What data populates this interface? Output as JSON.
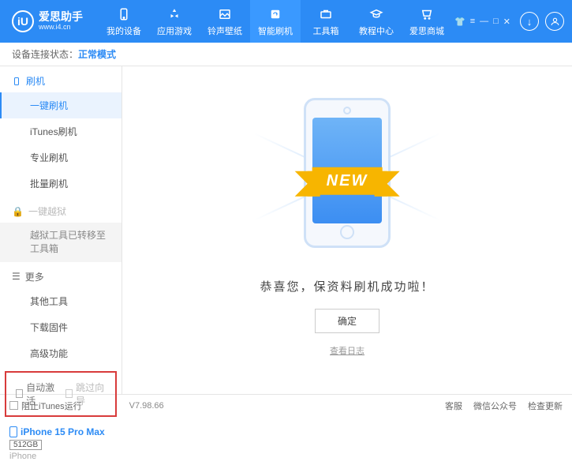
{
  "logo": {
    "icon": "iU",
    "title": "爱思助手",
    "subtitle": "www.i4.cn"
  },
  "nav": {
    "items": [
      {
        "label": "我的设备"
      },
      {
        "label": "应用游戏"
      },
      {
        "label": "铃声壁纸"
      },
      {
        "label": "智能刷机"
      },
      {
        "label": "工具箱"
      },
      {
        "label": "教程中心"
      },
      {
        "label": "爱思商城"
      }
    ]
  },
  "status": {
    "label": "设备连接状态：",
    "mode": "正常模式"
  },
  "sidebar": {
    "sec1": {
      "title": "刷机",
      "items": [
        "一键刷机",
        "iTunes刷机",
        "专业刷机",
        "批量刷机"
      ]
    },
    "sec2": {
      "title": "一键越狱",
      "note": "越狱工具已转移至工具箱"
    },
    "sec3": {
      "title": "更多",
      "items": [
        "其他工具",
        "下载固件",
        "高级功能"
      ]
    },
    "checks": {
      "auto_activate": "自动激活",
      "skip_setup": "跳过向导"
    },
    "device": {
      "name": "iPhone 15 Pro Max",
      "storage": "512GB",
      "type": "iPhone"
    }
  },
  "main": {
    "badge": "NEW",
    "success": "恭喜您，保资料刷机成功啦！",
    "ok": "确定",
    "log": "查看日志"
  },
  "footer": {
    "block": "阻止iTunes运行",
    "version": "V7.98.66",
    "links": [
      "客服",
      "微信公众号",
      "检查更新"
    ]
  }
}
